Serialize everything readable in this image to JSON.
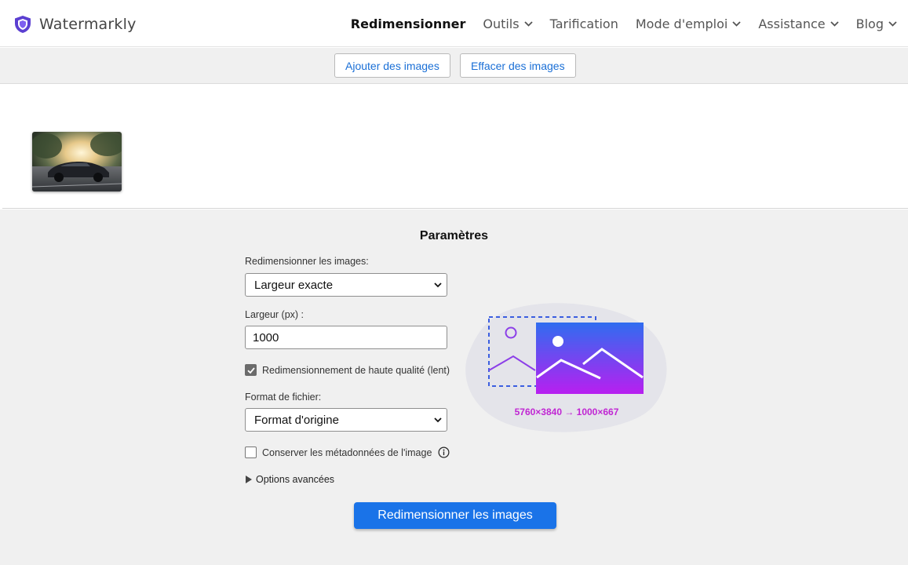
{
  "header": {
    "brand": "Watermarkly",
    "nav": [
      {
        "label": "Redimensionner",
        "active": true,
        "dropdown": false
      },
      {
        "label": "Outils",
        "active": false,
        "dropdown": true
      },
      {
        "label": "Tarification",
        "active": false,
        "dropdown": false
      },
      {
        "label": "Mode d'emploi",
        "active": false,
        "dropdown": true
      },
      {
        "label": "Assistance",
        "active": false,
        "dropdown": true
      },
      {
        "label": "Blog",
        "active": false,
        "dropdown": true
      }
    ]
  },
  "toolbar": {
    "add_label": "Ajouter des images",
    "clear_label": "Effacer des images"
  },
  "settings": {
    "title": "Paramètres",
    "resize_label": "Redimensionner les images:",
    "resize_value": "Largeur exacte",
    "width_label": "Largeur (px) :",
    "width_value": "1000",
    "hq_label": "Redimensionnement de haute qualité (lent)",
    "hq_checked": true,
    "format_label": "Format de fichier:",
    "format_value": "Format d'origine",
    "metadata_label": "Conserver les métadonnées de l'image",
    "metadata_checked": false,
    "advanced_label": "Options avancées",
    "submit_label": "Redimensionner les images",
    "illustration_caption": "5760×3840 → 1000×667"
  },
  "colors": {
    "accent": "#1a73e8",
    "link": "#1a6fd6",
    "brand_shield": "#5b3fd1",
    "caption": "#c026d3"
  }
}
